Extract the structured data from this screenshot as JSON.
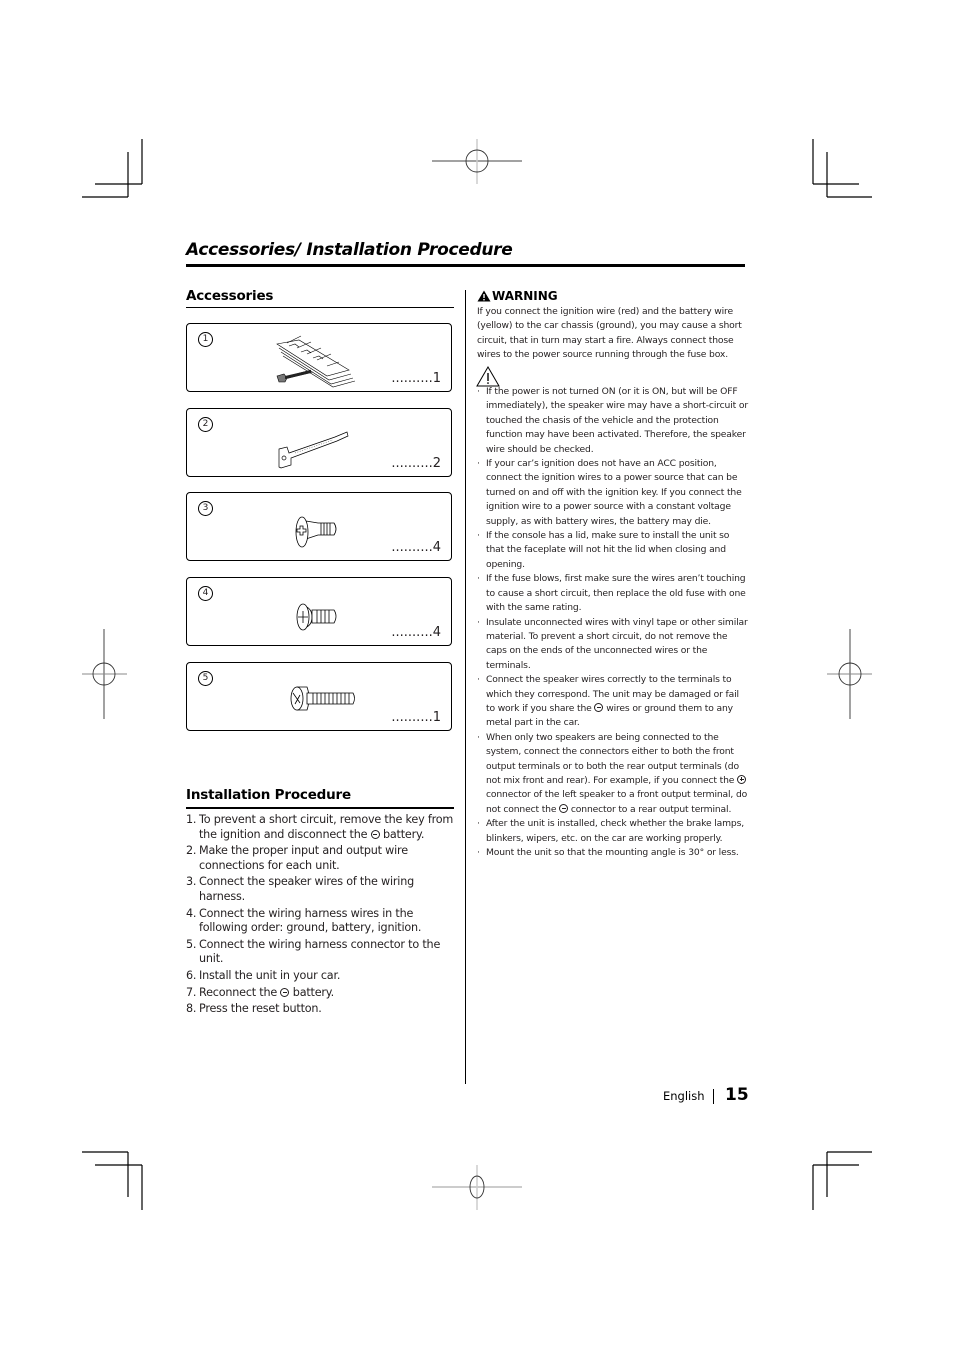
{
  "page": {
    "title": "Accessories/ Installation Procedure"
  },
  "accessories": {
    "heading": "Accessories",
    "items": [
      {
        "number": "1",
        "name": "wiring-harness",
        "quantity": "..........1"
      },
      {
        "number": "2",
        "name": "extraction-key",
        "quantity": "..........2"
      },
      {
        "number": "3",
        "name": "flat-head-screw",
        "quantity": "..........4"
      },
      {
        "number": "4",
        "name": "round-head-screw",
        "quantity": "..........4"
      },
      {
        "number": "5",
        "name": "long-screw",
        "quantity": "..........1"
      }
    ]
  },
  "installation": {
    "heading": "Installation Procedure",
    "steps": [
      {
        "n": "1.",
        "before": "To prevent a short circuit, remove the key from the ignition and disconnect the ",
        "symbol": "minus",
        "after": " battery."
      },
      {
        "n": "2.",
        "before": "Make the proper input and output wire connections for each unit.",
        "symbol": "",
        "after": ""
      },
      {
        "n": "3.",
        "before": "Connect the speaker wires of the wiring harness.",
        "symbol": "",
        "after": ""
      },
      {
        "n": "4.",
        "before": "Connect the wiring harness wires in the following order: ground, battery, ignition.",
        "symbol": "",
        "after": ""
      },
      {
        "n": "5.",
        "before": "Connect the wiring harness connector to the unit.",
        "symbol": "",
        "after": ""
      },
      {
        "n": "6.",
        "before": "Install the unit in your car.",
        "symbol": "",
        "after": ""
      },
      {
        "n": "7.",
        "before": "Reconnect the ",
        "symbol": "minus",
        "after": " battery."
      },
      {
        "n": "8.",
        "before": "Press the reset button.",
        "symbol": "",
        "after": ""
      }
    ]
  },
  "warning": {
    "heading": "WARNING",
    "text": "If you connect the ignition wire (red) and the battery wire (yellow) to the car chassis (ground), you may cause a short circuit, that in turn may start a fire. Always connect those wires to the power source running through the fuse box.",
    "caution_icon": "caution-triangle-icon"
  },
  "cautions": [
    {
      "parts": [
        "If the power is not turned ON (or it is ON, but will be OFF immediately), the speaker wire may have a short-circuit or touched the chasis of the vehicle and the protection function may have been activated. Therefore, the speaker wire should be checked."
      ]
    },
    {
      "parts": [
        "If your car’s ignition does not have an ACC position, connect the ignition wires to a power source that can be turned on and off with the ignition key. If you connect the ignition wire to a power source with a constant voltage supply, as with battery wires, the battery may die."
      ]
    },
    {
      "parts": [
        "If the console has a lid, make sure to install the unit so that the faceplate will not hit the lid when closing and opening."
      ]
    },
    {
      "parts": [
        "If the fuse blows, first make sure the wires aren’t touching to cause a short circuit, then replace the old fuse with one with the same rating."
      ]
    },
    {
      "parts": [
        "Insulate unconnected wires with vinyl tape or other similar material. To prevent a short circuit, do not remove the caps on the ends of the unconnected wires or the terminals."
      ]
    },
    {
      "parts": [
        "Connect the speaker wires correctly to the terminals to which they correspond. The unit may be damaged or fail to work if you share the ",
        {
          "symbol": "minus"
        },
        " wires or ground them to any metal part in the car."
      ]
    },
    {
      "parts": [
        "When only two speakers are being connected to the system, connect the connectors either to both the front output terminals or to both the rear output terminals (do not mix front and rear). For example, if you connect the ",
        {
          "symbol": "plus"
        },
        " connector of the left speaker to a front output terminal, do not connect the ",
        {
          "symbol": "minus"
        },
        " connector to a rear output terminal."
      ]
    },
    {
      "parts": [
        "After the unit is installed, check whether the brake lamps, blinkers, wipers, etc. on the car are working properly."
      ]
    },
    {
      "parts": [
        "Mount the unit so that the mounting angle is 30° or less."
      ]
    }
  ],
  "footer": {
    "language": "English",
    "page_number": "15"
  }
}
